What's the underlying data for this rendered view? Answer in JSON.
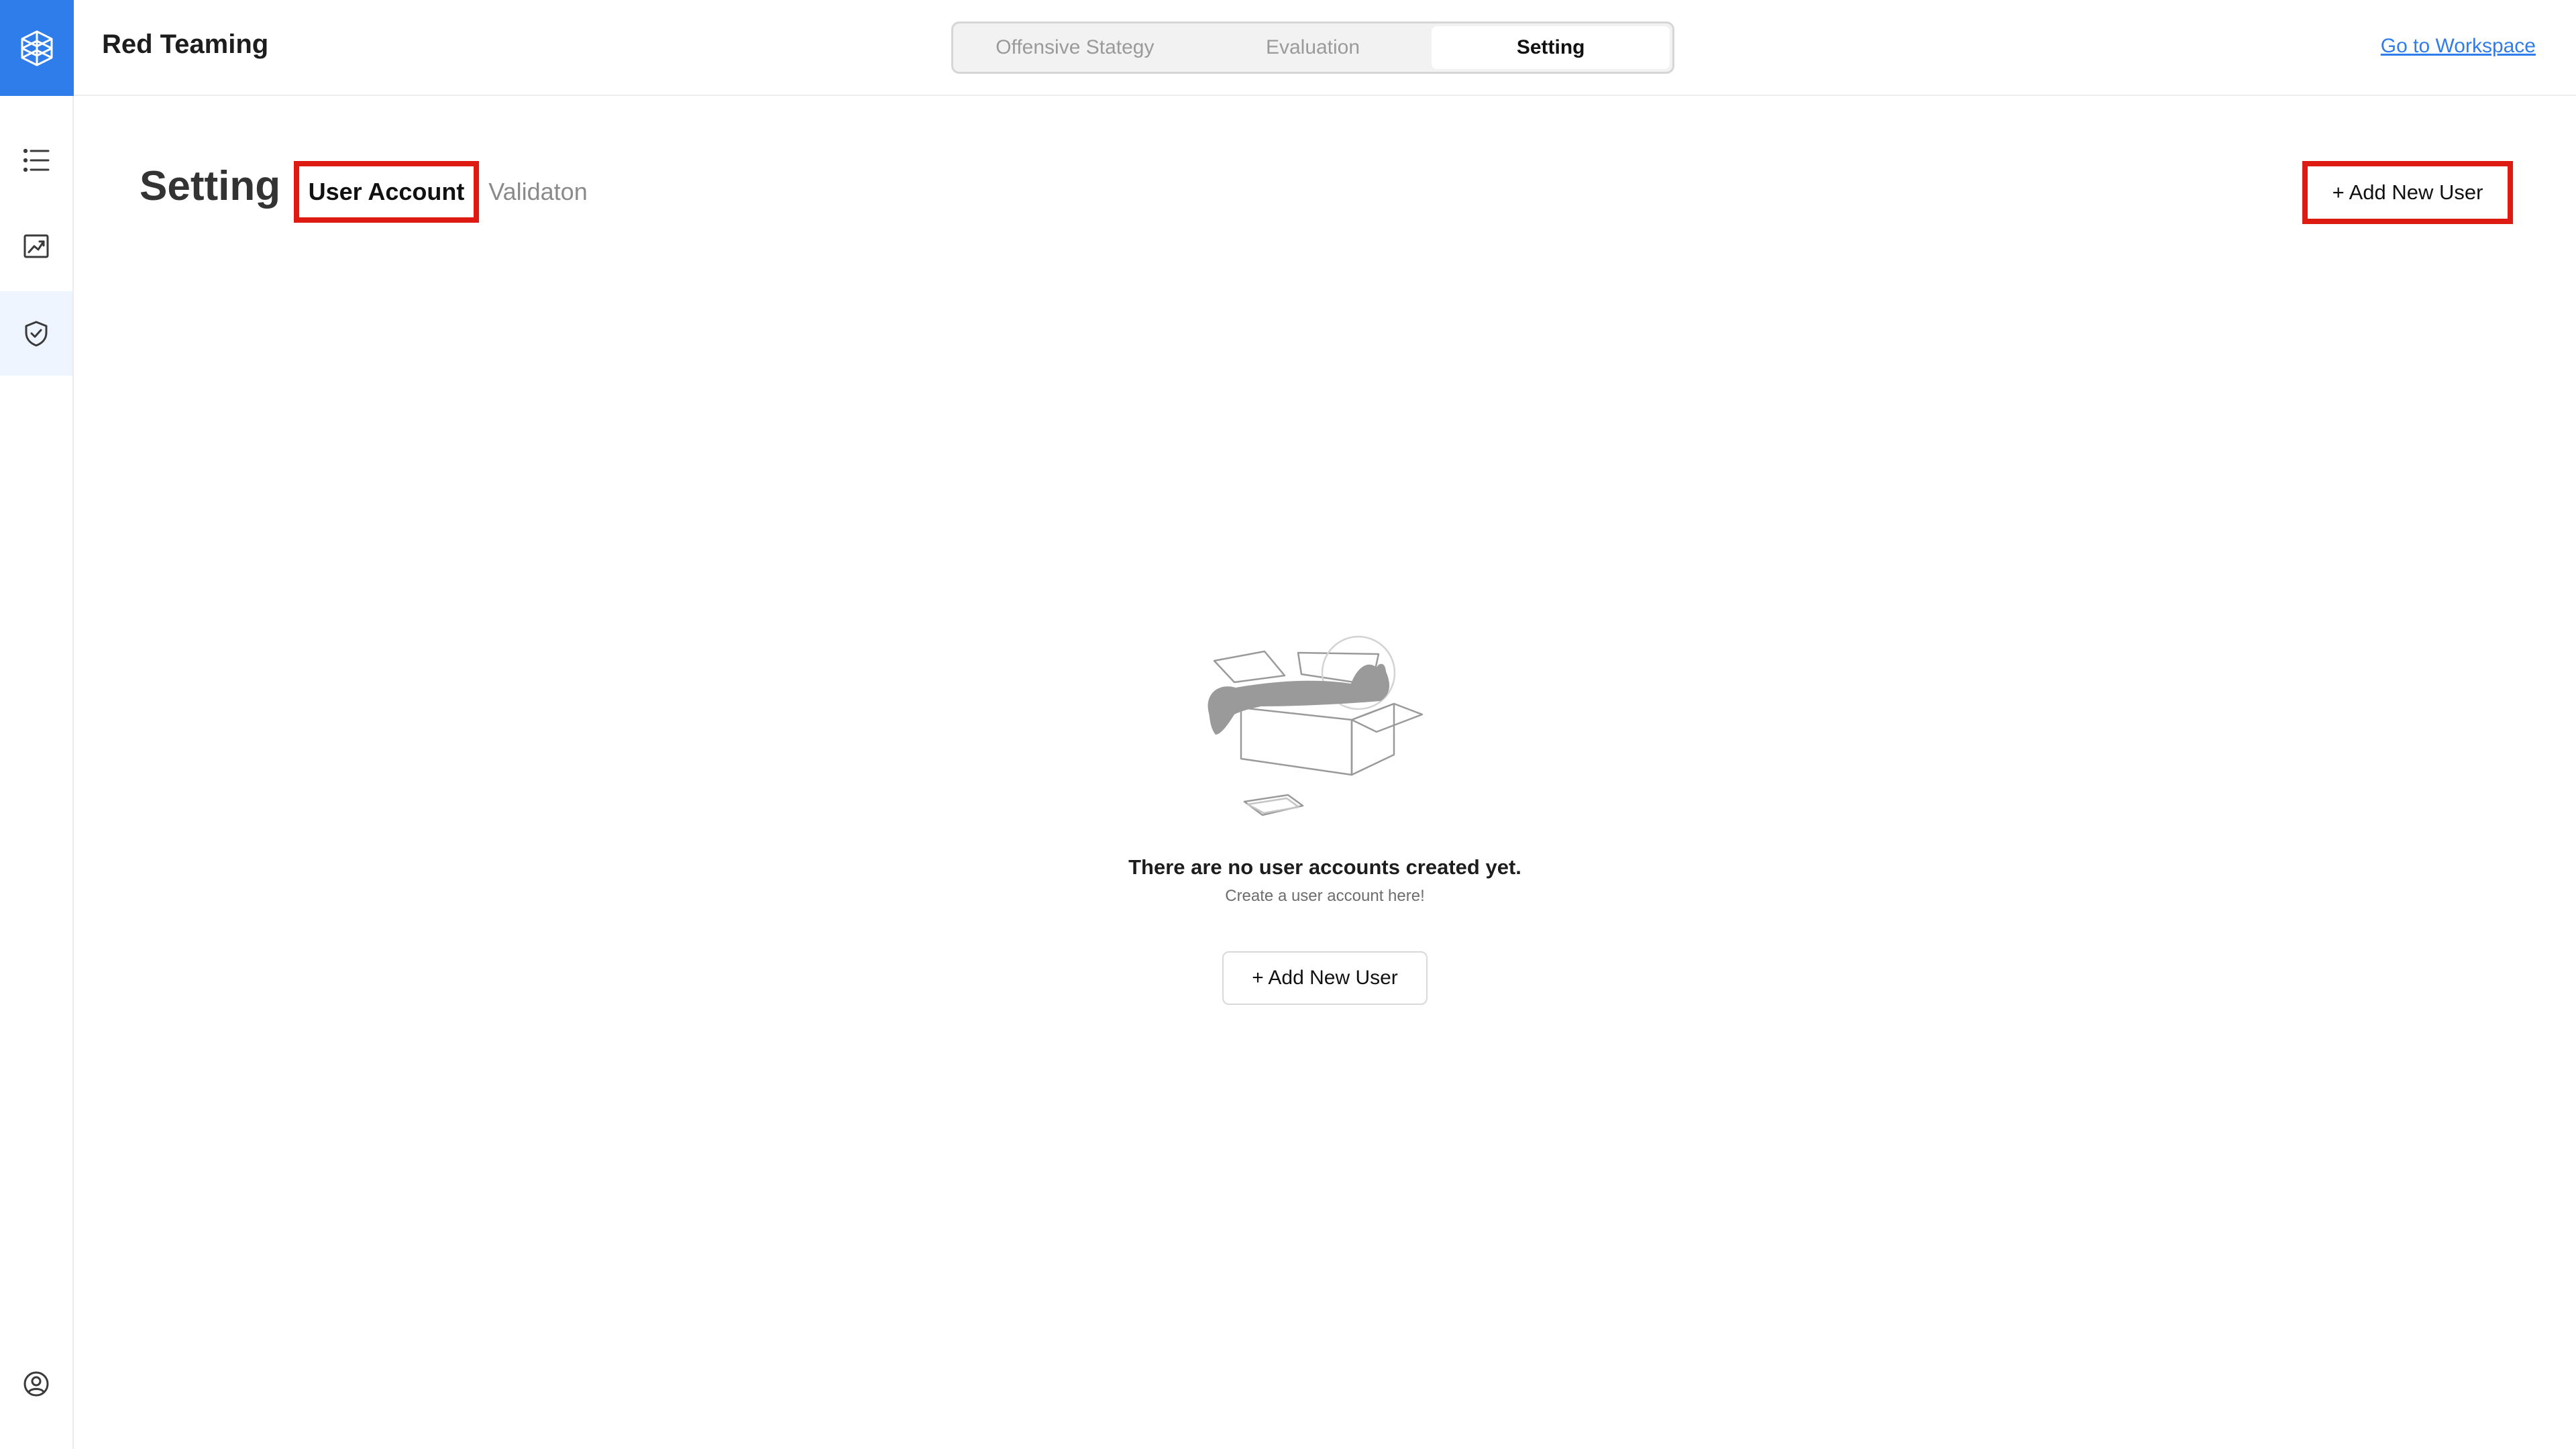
{
  "app": {
    "title": "Red Teaming",
    "accent_color": "#2f7dea",
    "highlight_color": "#dd1b12"
  },
  "header": {
    "tabs": [
      {
        "label": "Offensive Stategy",
        "active": false
      },
      {
        "label": "Evaluation",
        "active": false
      },
      {
        "label": "Setting",
        "active": true
      }
    ],
    "workspace_link": "Go to Workspace"
  },
  "sidebar": {
    "logo_icon": "cube-network-icon",
    "items": [
      {
        "icon": "list-icon",
        "active": false
      },
      {
        "icon": "chart-trend-icon",
        "active": false
      },
      {
        "icon": "shield-check-icon",
        "active": true
      }
    ],
    "bottom_icon": "user-circle-icon"
  },
  "page": {
    "title": "Setting",
    "subtabs": [
      {
        "label": "User Account",
        "active": true
      },
      {
        "label": "Validaton",
        "active": false
      }
    ],
    "add_user_label": "+ Add New User"
  },
  "empty_state": {
    "illustration": "empty-box-illustration",
    "title": "There are no user accounts created yet.",
    "subtitle": "Create a user account here!",
    "button_label": "+ Add New User"
  }
}
